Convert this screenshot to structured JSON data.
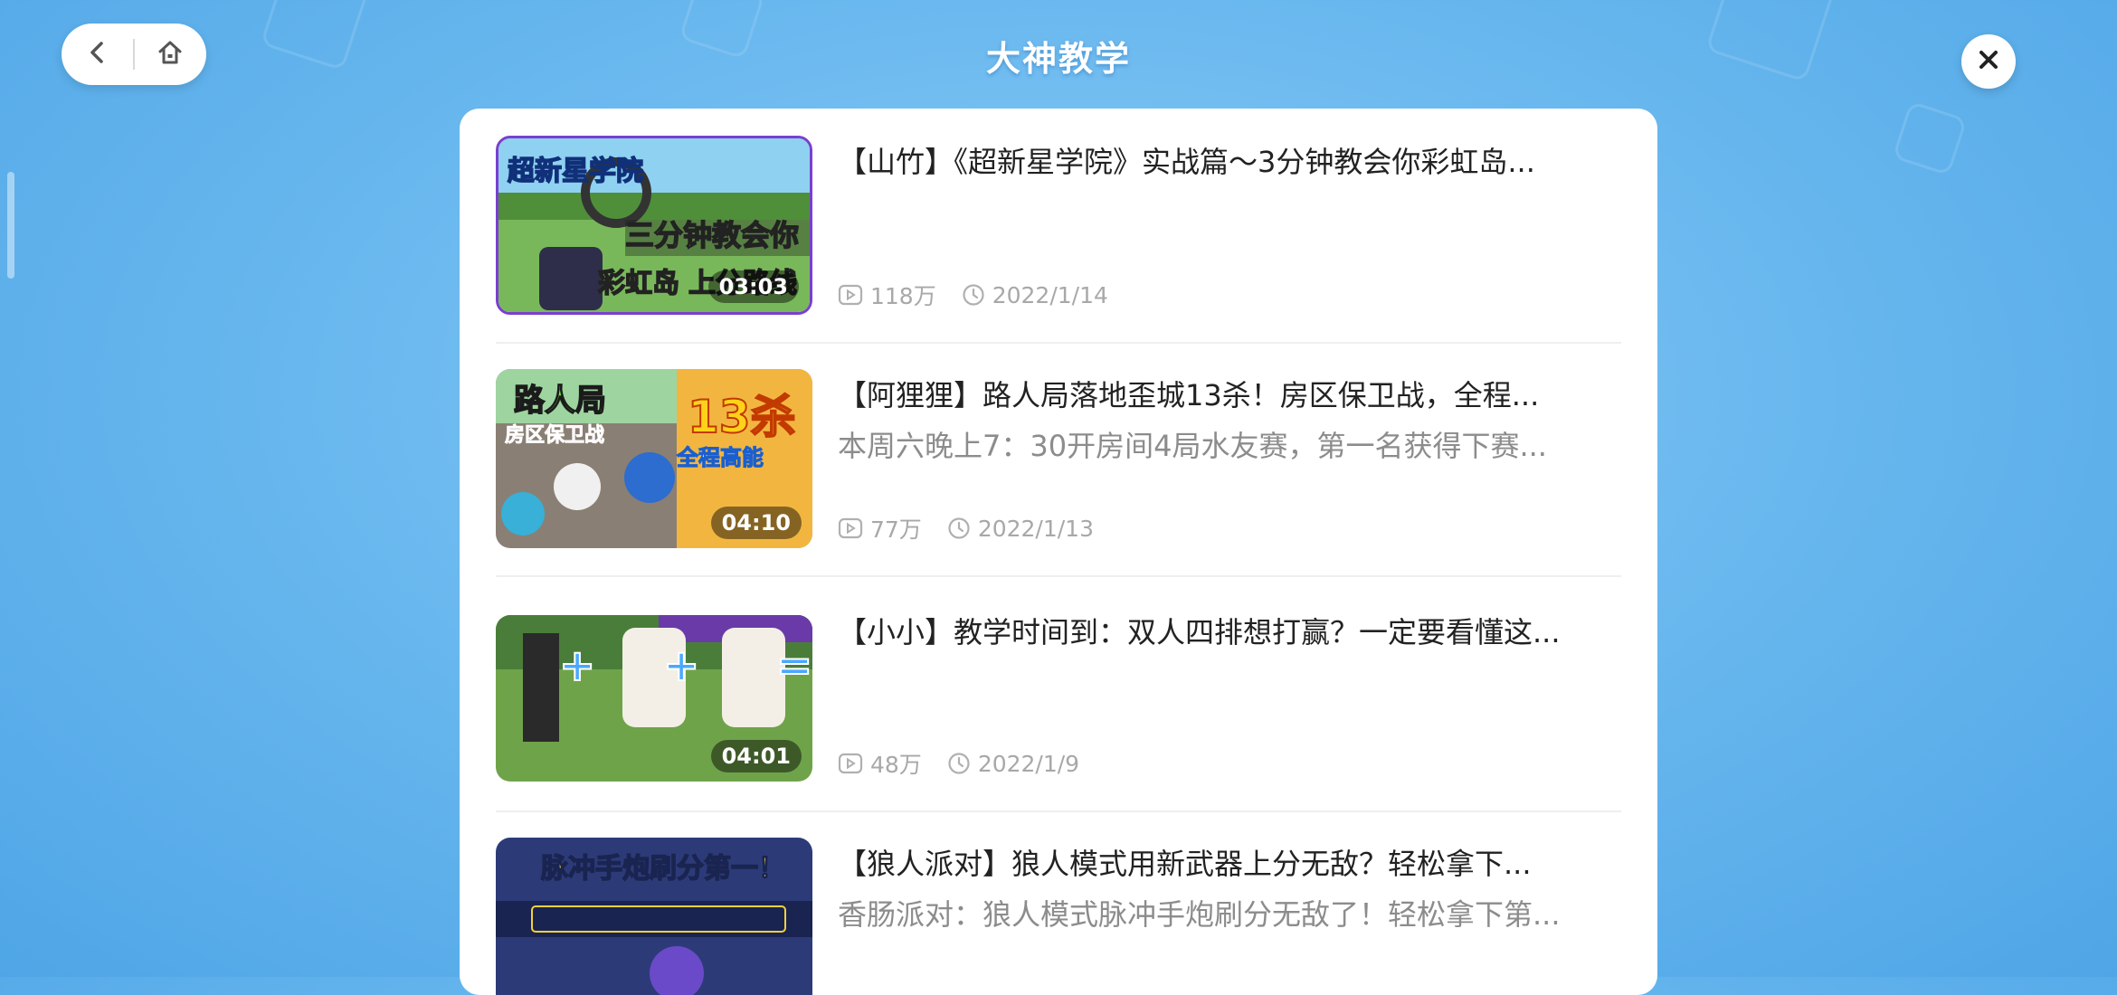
{
  "header": {
    "title": "大神教学"
  },
  "icons": {
    "back": "chevron-left-icon",
    "home": "home-icon",
    "close": "close-icon",
    "views": "play-icon",
    "date": "clock-icon"
  },
  "videos": [
    {
      "title": "【山竹】《超新星学院》实战篇～3分钟教会你彩虹岛...",
      "subtitle": "",
      "views": "118万",
      "date": "2022/1/14",
      "duration": "03:03",
      "thumb_text": [
        "超新星学院",
        "三分钟教会你",
        "彩虹岛",
        "上分路线"
      ]
    },
    {
      "title": "【阿狸狸】路人局落地歪城13杀！房区保卫战，全程...",
      "subtitle": "本周六晚上7：30开房间4局水友赛，第一名获得下赛...",
      "views": "77万",
      "date": "2022/1/13",
      "duration": "04:10",
      "thumb_text": [
        "路人局",
        "房区保卫战",
        "13杀",
        "全程高能"
      ]
    },
    {
      "title": "【小小】教学时间到：双人四排想打赢？一定要看懂这...",
      "subtitle": "",
      "views": "48万",
      "date": "2022/1/9",
      "duration": "04:01",
      "thumb_text": [
        "+",
        "+",
        "="
      ]
    },
    {
      "title": "【狼人派对】狼人模式用新武器上分无敌？轻松拿下...",
      "subtitle": "香肠派对：狼人模式脉冲手炮刷分无敌了！轻松拿下第...",
      "views": "",
      "date": "",
      "duration": "",
      "thumb_text": [
        "脉冲手炮刷分第一！"
      ]
    }
  ]
}
